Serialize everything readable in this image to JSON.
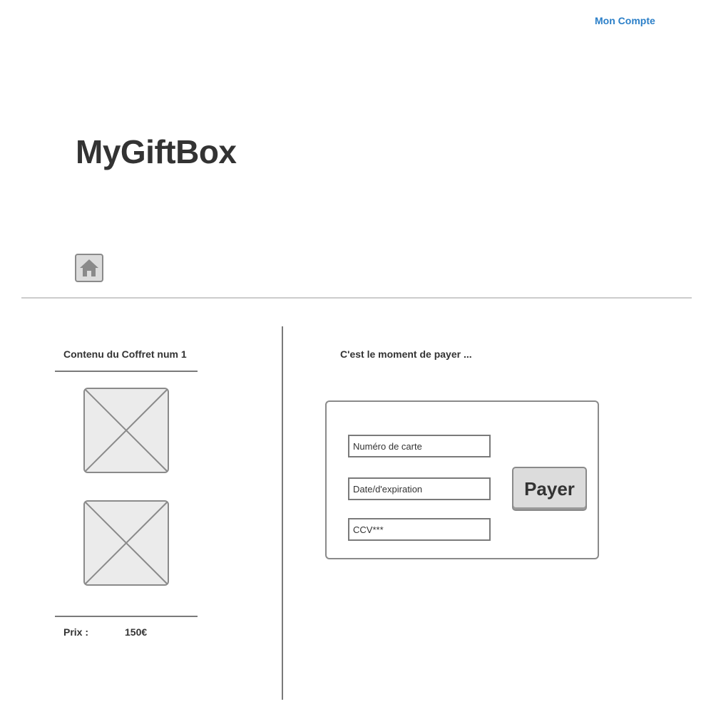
{
  "header": {
    "account_link": "Mon Compte",
    "brand": "MyGiftBox"
  },
  "nav": {
    "home_icon": "home-icon"
  },
  "box_panel": {
    "title": "Contenu du Coffret  num 1",
    "price_label": "Prix :",
    "price_value": "150€",
    "items": [
      {
        "icon": "image-placeholder-icon"
      },
      {
        "icon": "image-placeholder-icon"
      }
    ]
  },
  "payment": {
    "heading": "C'est le moment de payer ...",
    "card_number_placeholder": "Numéro de carte",
    "expiry_placeholder": "Date/d'expiration",
    "ccv_placeholder": "CCV***",
    "pay_label": "Payer"
  },
  "colors": {
    "link": "#2b7fc8",
    "text": "#333333",
    "border": "#8a8a8a",
    "button_bg": "#dcdcdc",
    "placeholder_bg": "#ebebeb"
  }
}
